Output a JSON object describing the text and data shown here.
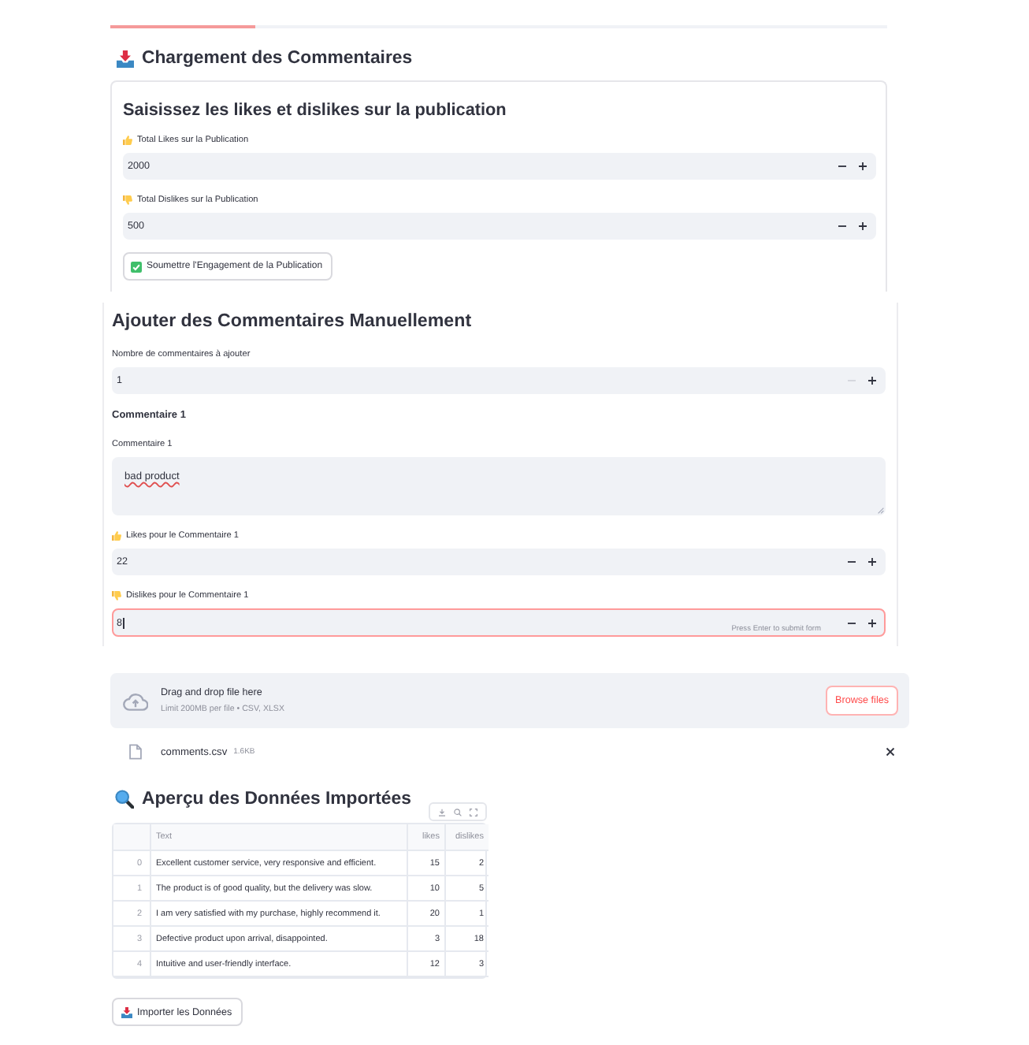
{
  "loading_section": {
    "title": "Chargement des Commentaires"
  },
  "engagement_form": {
    "title": "Saisissez les likes et dislikes sur la publication",
    "fields": [
      {
        "kind": "likes",
        "label": "Total Likes sur la Publication",
        "value": "2000",
        "focused": false,
        "decrement_disabled": false
      },
      {
        "kind": "dislikes",
        "label": "Total Dislikes sur la Publication",
        "value": "500",
        "focused": false,
        "decrement_disabled": false
      }
    ],
    "submit_button": "Soumettre l'Engagement de la Publication"
  },
  "manual_form": {
    "title": "Ajouter des Commentaires Manuellement",
    "fields": [
      {
        "kind": "count",
        "label": "Nombre de commentaires à ajouter",
        "value": "1",
        "focused": false,
        "decrement_disabled": true
      }
    ],
    "comments": [
      {
        "heading": "Commentaire 1",
        "fields": [
          {
            "kind": "text",
            "label": "Commentaire 1",
            "value": "bad product",
            "misspelled": true
          },
          {
            "kind": "likes",
            "label": "Likes pour le Commentaire 1",
            "value": "22",
            "focused": false,
            "decrement_disabled": false
          },
          {
            "kind": "dislikes",
            "label": "Dislikes pour le Commentaire 1",
            "value": "8",
            "focused": true,
            "decrement_disabled": false,
            "hint": "Press Enter to submit form"
          }
        ]
      }
    ]
  },
  "file_uploader": {
    "title": "Drag and drop file here",
    "limits": "Limit 200MB per file • CSV, XLSX",
    "button": "Browse files",
    "files": [
      {
        "name": "comments.csv",
        "size": "1.6KB"
      }
    ]
  },
  "data_preview": {
    "title": "Aperçu des Données Importées",
    "table": {
      "columns": [
        "Text",
        "likes",
        "dislikes"
      ],
      "rows": [
        {
          "index": "0",
          "text": "Excellent customer service, very responsive and efficient.",
          "likes": "15",
          "dislikes": "2"
        },
        {
          "index": "1",
          "text": "The product is of good quality, but the delivery was slow.",
          "likes": "10",
          "dislikes": "5"
        },
        {
          "index": "2",
          "text": "I am very satisfied with my purchase, highly recommend it.",
          "likes": "20",
          "dislikes": "1"
        },
        {
          "index": "3",
          "text": "Defective product upon arrival, disappointed.",
          "likes": "3",
          "dislikes": "18"
        },
        {
          "index": "4",
          "text": "Intuitive and user-friendly interface.",
          "likes": "12",
          "dislikes": "3"
        }
      ]
    },
    "import_button": "Importer les Données"
  }
}
